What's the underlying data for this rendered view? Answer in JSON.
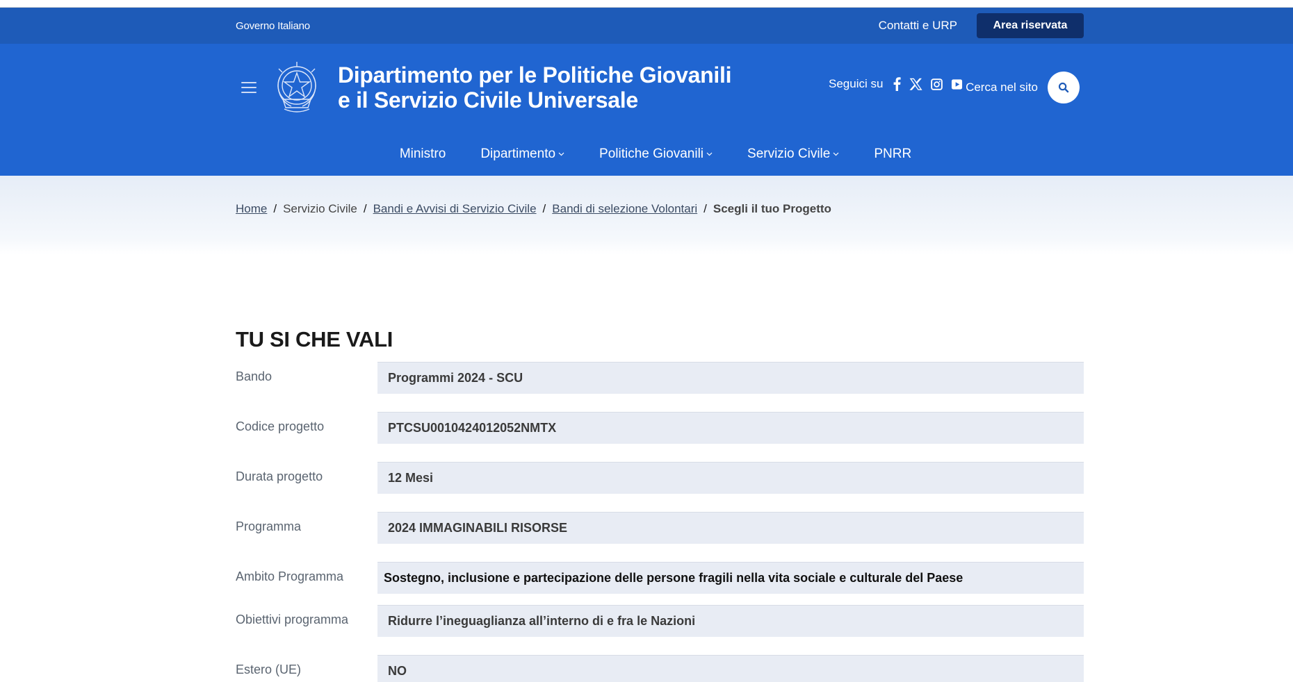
{
  "slim_header": {
    "gov_label": "Governo Italiano",
    "contacts_label": "Contatti e URP",
    "reserved_label": "Area riservata"
  },
  "header": {
    "title_line1": "Dipartimento per le Politiche Giovanili",
    "title_line2": "e il Servizio Civile Universale",
    "follow_label": "Seguici su",
    "search_label": "Cerca nel sito",
    "social_icons": [
      "facebook-icon",
      "x-icon",
      "instagram-icon",
      "youtube-icon"
    ]
  },
  "nav": {
    "items": [
      {
        "label": "Ministro",
        "dropdown": false
      },
      {
        "label": "Dipartimento",
        "dropdown": true
      },
      {
        "label": "Politiche Giovanili",
        "dropdown": true
      },
      {
        "label": "Servizio Civile",
        "dropdown": true
      },
      {
        "label": "PNRR",
        "dropdown": false
      }
    ]
  },
  "breadcrumb": {
    "home": "Home",
    "level1": "Servizio Civile",
    "level2": "Bandi e Avvisi di Servizio Civile",
    "level3": "Bandi di selezione Volontari",
    "current": "Scegli il tuo Progetto"
  },
  "project": {
    "title": "TU SI CHE VALI",
    "fields": [
      {
        "label": "Bando",
        "value": "Programmi 2024 - SCU"
      },
      {
        "label": "Codice progetto",
        "value": "PTCSU0010424012052NMTX"
      },
      {
        "label": "Durata progetto",
        "value": "12 Mesi"
      },
      {
        "label": "Programma",
        "value": "2024 IMMAGINABILI RISORSE"
      },
      {
        "label": "Ambito Programma",
        "value": "Sostegno, inclusione e partecipazione delle persone fragili nella vita sociale e culturale del Paese"
      },
      {
        "label": "Obiettivi programma",
        "value": "Ridurre l’ineguaglianza all’interno di e fra le Nazioni"
      },
      {
        "label": "Estero (UE)",
        "value": "NO"
      }
    ]
  },
  "colors": {
    "primary": "#2065d1",
    "slim": "#1e5bb8",
    "reserved_btn": "#0f2f6b",
    "field_bg": "#e8ecf4"
  }
}
